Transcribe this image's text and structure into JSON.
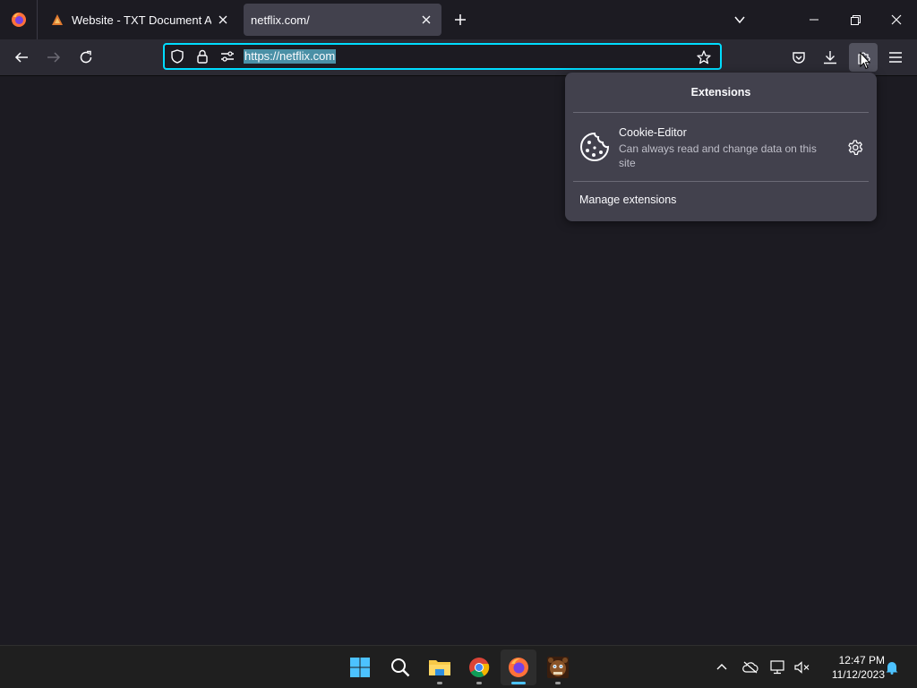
{
  "browser": {
    "tabs": [
      {
        "label": "Website - TXT Document Access",
        "active": false
      },
      {
        "label": "netflix.com/",
        "active": true
      }
    ],
    "url": "https://netflix.com",
    "icons": {
      "menu": "firefox-icon",
      "back": "back-arrow-icon",
      "forward": "forward-arrow-icon",
      "reload": "reload-icon",
      "shield": "shield-icon",
      "lock": "lock-icon",
      "permissions": "permissions-icon",
      "bookmark": "star-icon",
      "pocket": "pocket-icon",
      "downloads": "download-icon",
      "extensions": "puzzle-icon",
      "app_menu": "hamburger-icon"
    }
  },
  "extensions_panel": {
    "title": "Extensions",
    "items": [
      {
        "name": "Cookie-Editor",
        "description": "Can always read and change data on this site"
      }
    ],
    "manage_label": "Manage extensions"
  },
  "taskbar": {
    "apps": [
      "start",
      "search",
      "file-explorer",
      "chrome",
      "firefox",
      "fnaf-game"
    ],
    "clock": {
      "time": "12:47 PM",
      "date": "11/12/2023"
    }
  },
  "colors": {
    "accent": "#00ddff",
    "panel": "#42414d",
    "toolbar": "#2b2a33",
    "background": "#1c1b22",
    "taskbar_active": "#4cc2ff"
  }
}
